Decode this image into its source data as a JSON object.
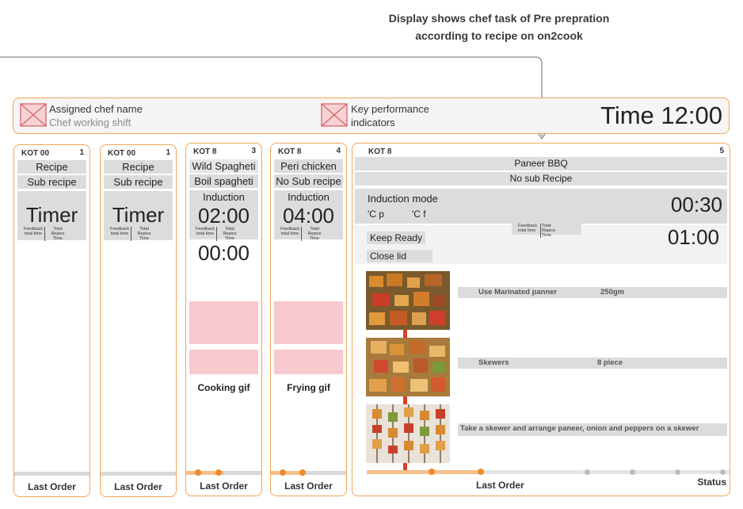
{
  "annotation": {
    "line1": "Display shows chef task of Pre prepration",
    "line2": "according to recipe on on2cook"
  },
  "header": {
    "chef_name": "Assigned chef name",
    "chef_shift": "Chef working shift",
    "kpi_line1": "Key performance",
    "kpi_line2": "indicators",
    "time": "Time 12:00"
  },
  "columns": [
    {
      "kot": "KOT 00",
      "num": "1",
      "recipe": "Recipe",
      "sub": "Sub recipe",
      "timer": "Timer",
      "feedback": "Feedback total time",
      "total": "Total Repice Time",
      "last": "Last Order"
    },
    {
      "kot": "KOT 00",
      "num": "1",
      "recipe": "Recipe",
      "sub": "Sub recipe",
      "timer": "Timer",
      "feedback": "Feedback total time",
      "total": "Total Repice Time",
      "last": "Last Order"
    },
    {
      "kot": "KOT 8",
      "num": "3",
      "recipe": "Wild Spagheti",
      "sub": "Boil spagheti",
      "mode": "Induction",
      "timer": "02:00",
      "feedback": "Feedback total time",
      "total": "Total Repice Time",
      "timer2": "00:00",
      "gif": "Cooking gif",
      "last": "Last Order"
    },
    {
      "kot": "KOT 8",
      "num": "4",
      "recipe": "Peri chicken",
      "sub": "No Sub recipe",
      "mode": "Induction",
      "timer": "04:00",
      "feedback": "Feedback total time",
      "total": "Total Repice Time",
      "gif": "Frying gif",
      "last": "Last Order"
    }
  ],
  "main": {
    "kot": "KOT 8",
    "num": "5",
    "recipe": "Paneer BBQ",
    "sub": "No sub Recipe",
    "mode": "Induction mode",
    "temp_c": "'C p",
    "temp_f": "'C f",
    "timer1": "00:30",
    "feedback": "Feedback total time",
    "total": "Total Repice Time",
    "timer2": "01:00",
    "keep_ready": "Keep Ready",
    "close_lid": "Close lid",
    "steps": [
      {
        "text": "Use Marinated panner",
        "qty": "250gm"
      },
      {
        "text": "Skewers",
        "qty": "8 piece"
      },
      {
        "text": "Take a skewer and arrange paneer, onion and peppers on a skewer",
        "qty": ""
      }
    ],
    "last": "Last Order",
    "status": "Status"
  }
}
